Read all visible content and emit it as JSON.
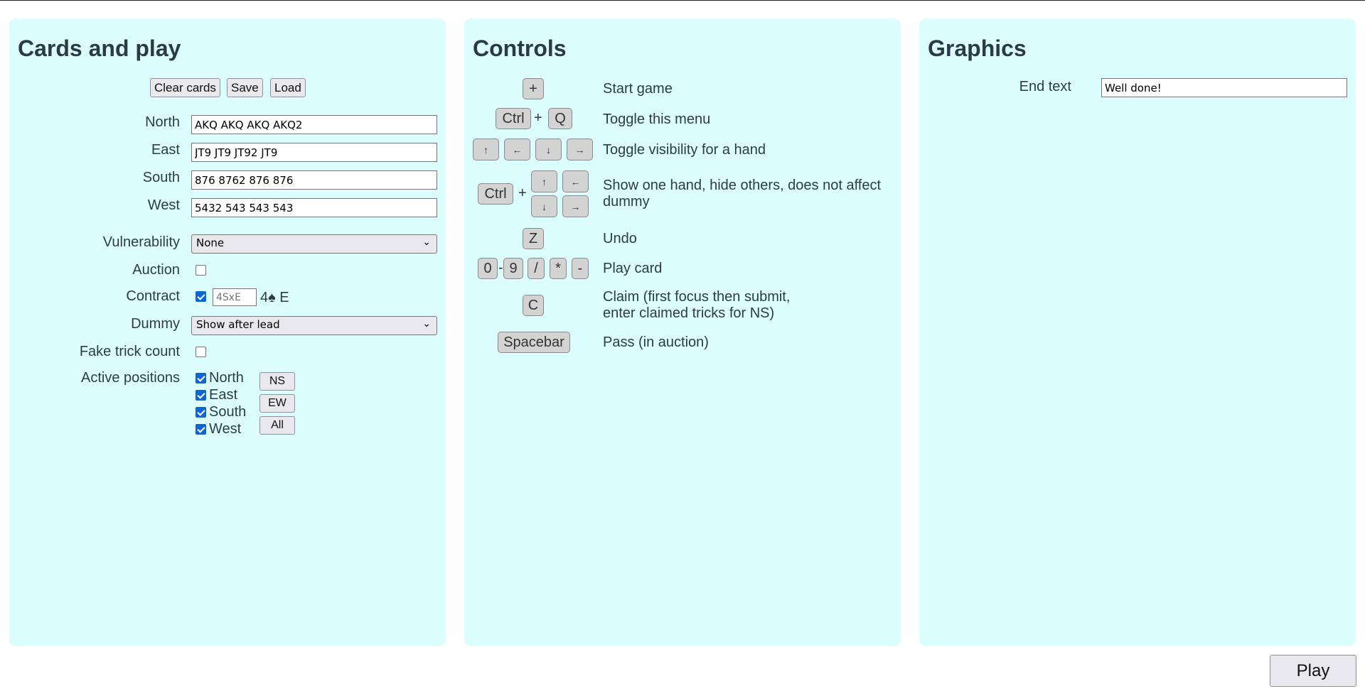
{
  "cards_panel": {
    "title": "Cards and play",
    "buttons": {
      "clear": "Clear cards",
      "save": "Save",
      "load": "Load"
    },
    "hands": {
      "north_label": "North",
      "north_value": "AKQ AKQ AKQ AKQ2",
      "east_label": "East",
      "east_value": "JT9 JT9 JT92 JT9",
      "south_label": "South",
      "south_value": "876 8762 876 876",
      "west_label": "West",
      "west_value": "5432 543 543 543"
    },
    "vulnerability": {
      "label": "Vulnerability",
      "selected": "None"
    },
    "auction": {
      "label": "Auction",
      "checked": false
    },
    "contract": {
      "label": "Contract",
      "checked": true,
      "placeholder": "4SxE",
      "display": "4♠ E"
    },
    "dummy": {
      "label": "Dummy",
      "selected": "Show after lead"
    },
    "fake_trick_count": {
      "label": "Fake trick count",
      "checked": false
    },
    "active_positions": {
      "label": "Active positions",
      "positions": [
        "North",
        "East",
        "South",
        "West"
      ],
      "checked": [
        true,
        true,
        true,
        true
      ],
      "buttons": [
        "NS",
        "EW",
        "All"
      ]
    }
  },
  "controls_panel": {
    "title": "Controls",
    "rows": [
      {
        "keys": [
          "+"
        ],
        "desc": "Start game"
      },
      {
        "keys": [
          "Ctrl",
          "+",
          "Q"
        ],
        "desc": "Toggle this menu"
      },
      {
        "keys": [
          "↑",
          "←",
          "↓",
          "→"
        ],
        "desc": "Toggle visibility for a hand"
      },
      {
        "keys": [
          "Ctrl",
          "+",
          "↑",
          "←",
          "↓",
          "→"
        ],
        "desc": "Show one hand, hide others, does not affect dummy"
      },
      {
        "keys": [
          "Z"
        ],
        "desc": "Undo"
      },
      {
        "keys": [
          "0",
          "-",
          "9",
          "/",
          "*",
          "-"
        ],
        "desc": "Play card"
      },
      {
        "keys": [
          "C"
        ],
        "desc_line1": "Claim (first focus then submit,",
        "desc_line2": "enter claimed tricks for NS)"
      },
      {
        "keys": [
          "Spacebar"
        ],
        "desc": "Pass (in auction)"
      }
    ]
  },
  "graphics_panel": {
    "title": "Graphics",
    "end_text": {
      "label": "End text",
      "value": "Well done!"
    }
  },
  "play_button": "Play",
  "colors": {
    "panel_bg": "#dcfefe",
    "checkbox_accent": "#0a66d6",
    "heading": "#2a3a47"
  }
}
